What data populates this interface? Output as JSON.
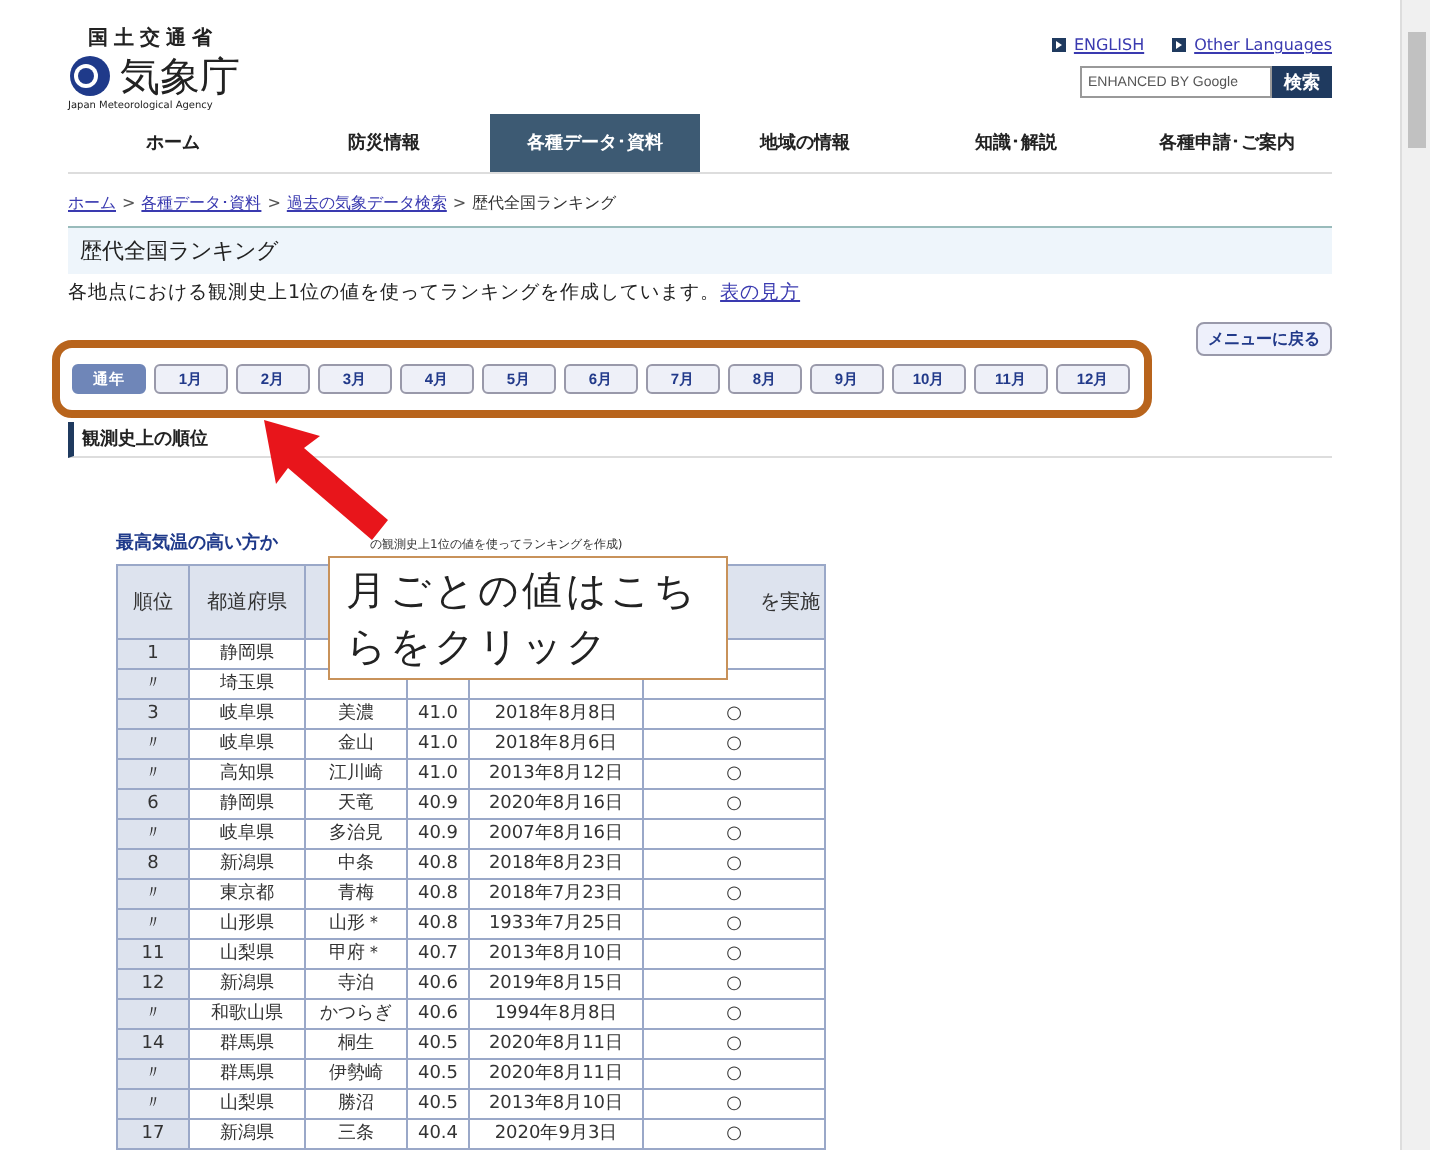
{
  "header": {
    "ministry": "国土交通省",
    "agency": "気象庁",
    "agency_en": "Japan Meteorological Agency",
    "links": [
      "ENGLISH",
      "Other Languages"
    ],
    "search": {
      "placeholder": "ENHANCED BY Google",
      "button": "検索"
    }
  },
  "nav": [
    {
      "label": "ホーム",
      "selected": false
    },
    {
      "label": "防災情報",
      "selected": false
    },
    {
      "label": "各種データ･資料",
      "selected": true
    },
    {
      "label": "地域の情報",
      "selected": false
    },
    {
      "label": "知識･解説",
      "selected": false
    },
    {
      "label": "各種申請･ご案内",
      "selected": false
    }
  ],
  "breadcrumb": {
    "links": [
      "ホーム",
      "各種データ･資料",
      "過去の気象データ検索"
    ],
    "separator": ">",
    "current": "歴代全国ランキング"
  },
  "page_title": "歴代全国ランキング",
  "intro": {
    "text": "各地点における観測史上1位の値を使ってランキングを作成しています。",
    "link": "表の見方"
  },
  "menu_button": "メニューに戻る",
  "months": [
    {
      "label": "通年",
      "selected": true
    },
    {
      "label": "1月",
      "selected": false
    },
    {
      "label": "2月",
      "selected": false
    },
    {
      "label": "3月",
      "selected": false
    },
    {
      "label": "4月",
      "selected": false
    },
    {
      "label": "5月",
      "selected": false
    },
    {
      "label": "6月",
      "selected": false
    },
    {
      "label": "7月",
      "selected": false
    },
    {
      "label": "8月",
      "selected": false
    },
    {
      "label": "9月",
      "selected": false
    },
    {
      "label": "10月",
      "selected": false
    },
    {
      "label": "11月",
      "selected": false
    },
    {
      "label": "12月",
      "selected": false
    }
  ],
  "section_heading": "観測史上の順位",
  "table": {
    "caption": "最高気温の高い方か",
    "caption_note": "の観測史上1位の値を使ってランキングを作成)",
    "columns": [
      "順位",
      "都道府県",
      null,
      null,
      null,
      "を実施"
    ],
    "rows": [
      [
        "1",
        "静岡県",
        null,
        null,
        null,
        null
      ],
      [
        "〃",
        "埼玉県",
        null,
        null,
        null,
        null
      ],
      [
        "3",
        "岐阜県",
        "美濃",
        "41.0",
        "2018年8月8日",
        "○"
      ],
      [
        "〃",
        "岐阜県",
        "金山",
        "41.0",
        "2018年8月6日",
        "○"
      ],
      [
        "〃",
        "高知県",
        "江川崎",
        "41.0",
        "2013年8月12日",
        "○"
      ],
      [
        "6",
        "静岡県",
        "天竜",
        "40.9",
        "2020年8月16日",
        "○"
      ],
      [
        "〃",
        "岐阜県",
        "多治見",
        "40.9",
        "2007年8月16日",
        "○"
      ],
      [
        "8",
        "新潟県",
        "中条",
        "40.8",
        "2018年8月23日",
        "○"
      ],
      [
        "〃",
        "東京都",
        "青梅",
        "40.8",
        "2018年7月23日",
        "○"
      ],
      [
        "〃",
        "山形県",
        "山形＊",
        "40.8",
        "1933年7月25日",
        "○"
      ],
      [
        "11",
        "山梨県",
        "甲府＊",
        "40.7",
        "2013年8月10日",
        "○"
      ],
      [
        "12",
        "新潟県",
        "寺泊",
        "40.6",
        "2019年8月15日",
        "○"
      ],
      [
        "〃",
        "和歌山県",
        "かつらぎ",
        "40.6",
        "1994年8月8日",
        "○"
      ],
      [
        "14",
        "群馬県",
        "桐生",
        "40.5",
        "2020年8月11日",
        "○"
      ],
      [
        "〃",
        "群馬県",
        "伊勢崎",
        "40.5",
        "2020年8月11日",
        "○"
      ],
      [
        "〃",
        "山梨県",
        "勝沼",
        "40.5",
        "2013年8月10日",
        "○"
      ],
      [
        "17",
        "新潟県",
        "三条",
        "40.4",
        "2020年9月3日",
        "○"
      ]
    ]
  },
  "callout": "月ごとの値はこちらをクリック"
}
